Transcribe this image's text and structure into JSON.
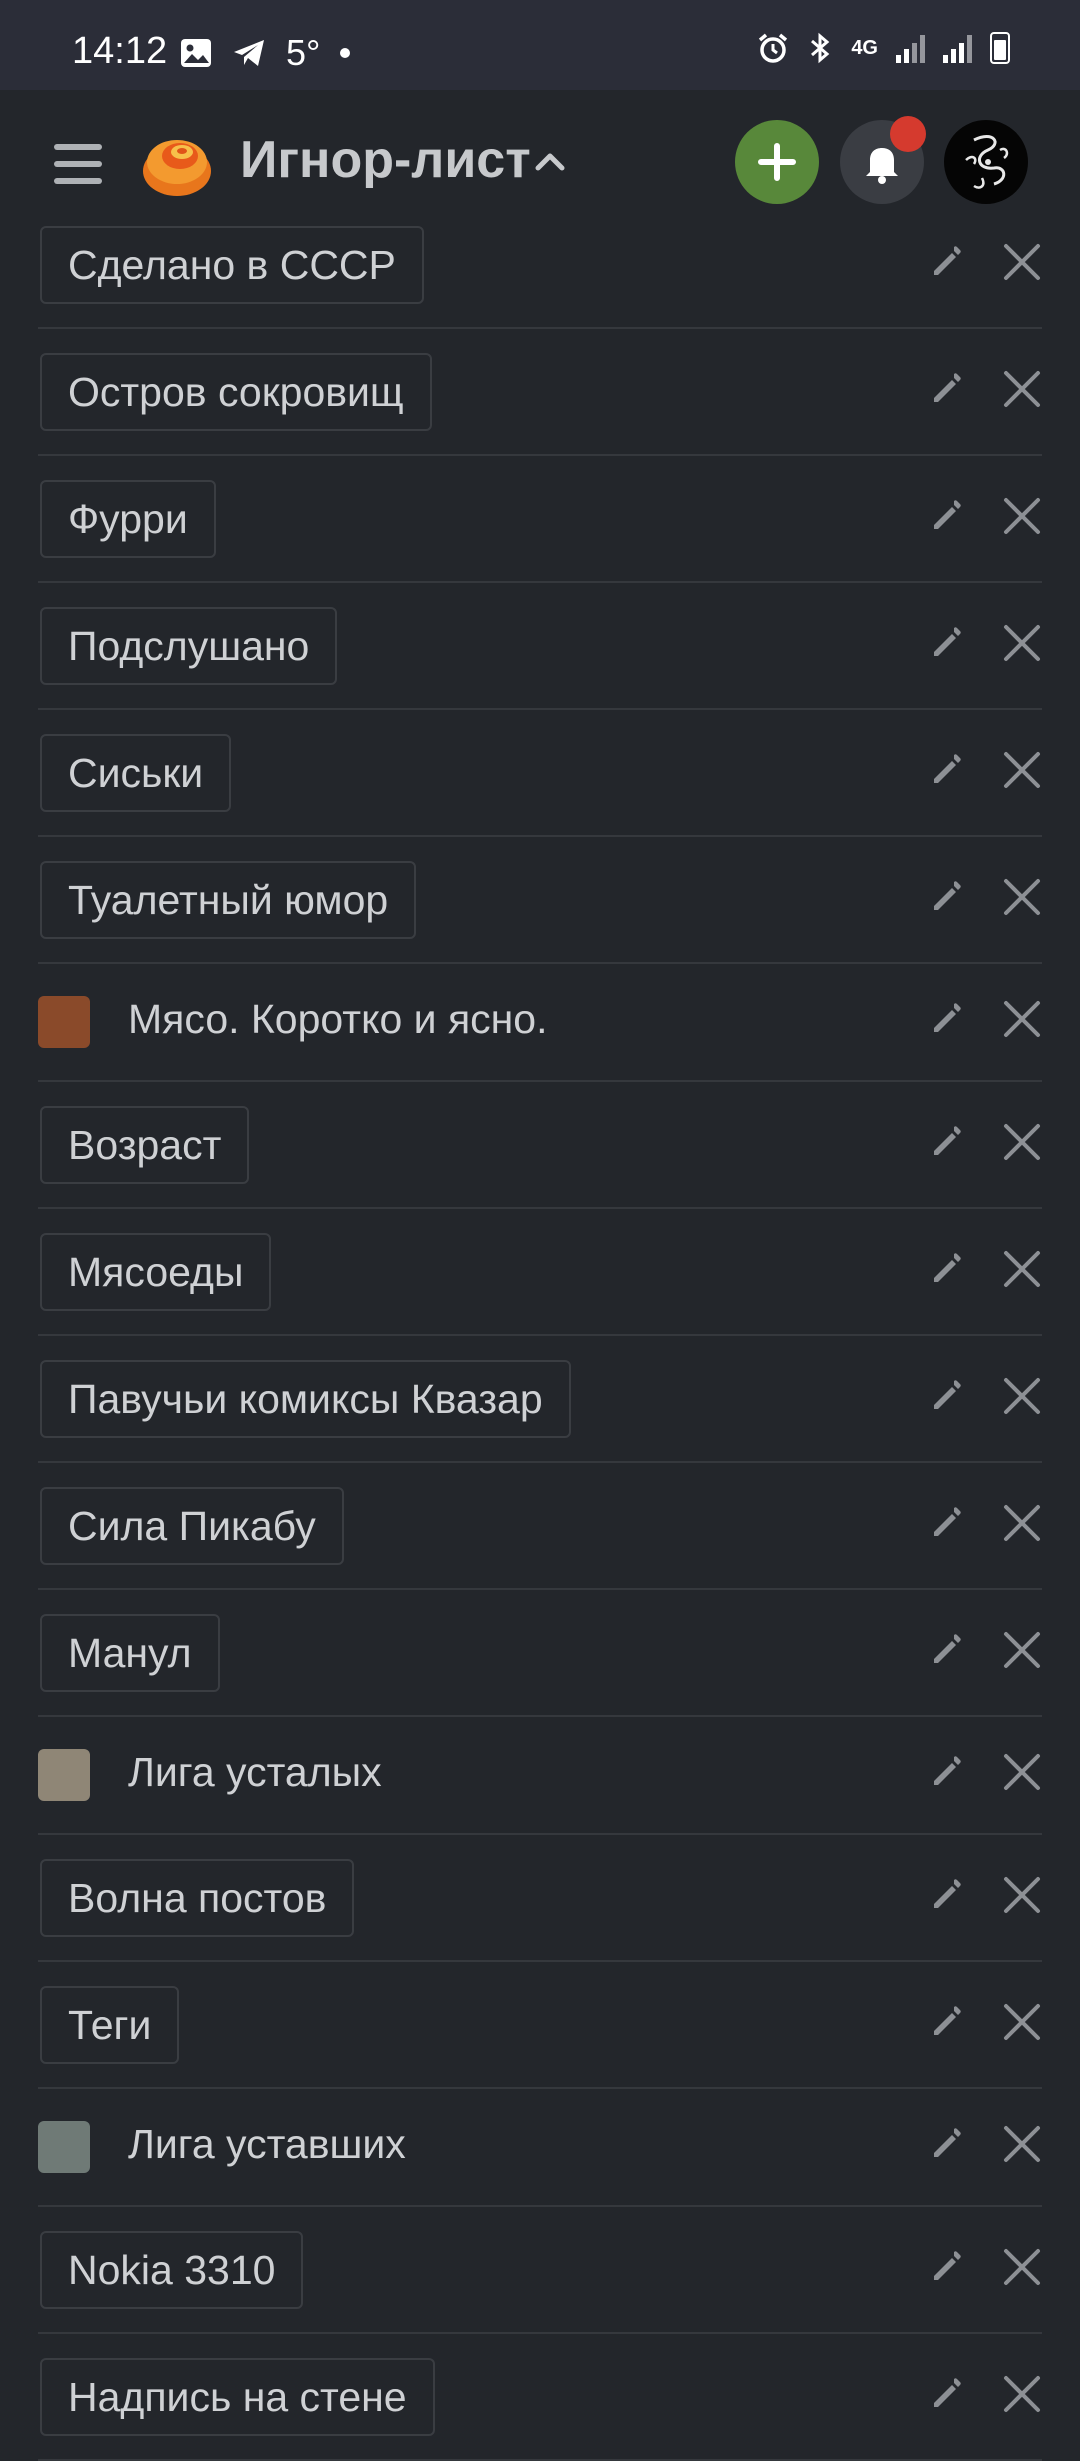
{
  "status_bar": {
    "time": "14:12",
    "temperature": "5°",
    "network": "4G",
    "icons": [
      "image-icon",
      "telegram-icon",
      "alarm-icon",
      "bluetooth-icon",
      "signal-icon",
      "battery-icon"
    ]
  },
  "header": {
    "title": "Игнор-лист",
    "add_icon": "plus-icon",
    "bell_icon": "bell-icon",
    "accent": "#58883a",
    "badge_color": "#d53a2e"
  },
  "items": [
    {
      "label": "Сделано в СССР",
      "type": "tag"
    },
    {
      "label": "Остров сокровищ",
      "type": "tag"
    },
    {
      "label": "Фурри",
      "type": "tag"
    },
    {
      "label": "Подслушано",
      "type": "tag"
    },
    {
      "label": "Сиськи",
      "type": "tag"
    },
    {
      "label": "Туалетный юмор",
      "type": "tag"
    },
    {
      "label": "Мясо. Коротко и ясно.",
      "type": "community",
      "thumb_color": "#8a4a2a"
    },
    {
      "label": "Возраст",
      "type": "tag"
    },
    {
      "label": "Мясоеды",
      "type": "tag"
    },
    {
      "label": "Павучьи комиксы Квазар",
      "type": "tag"
    },
    {
      "label": "Сила Пикабу",
      "type": "tag"
    },
    {
      "label": "Манул",
      "type": "tag"
    },
    {
      "label": "Лига усталых",
      "type": "community",
      "thumb_color": "#8f8676"
    },
    {
      "label": "Волна постов",
      "type": "tag"
    },
    {
      "label": "Теги",
      "type": "tag"
    },
    {
      "label": "Лига уставших",
      "type": "community",
      "thumb_color": "#6f7a76"
    },
    {
      "label": "Nokia 3310",
      "type": "tag"
    },
    {
      "label": "Надпись на стене",
      "type": "tag"
    }
  ]
}
